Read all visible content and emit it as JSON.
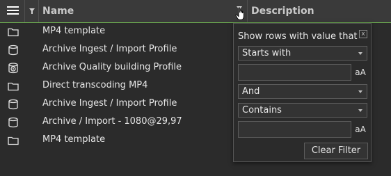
{
  "header": {
    "menu_icon": "hamburger-menu-icon",
    "filter_icon": "funnel-icon",
    "name_label": "Name",
    "description_label": "Description"
  },
  "rows": [
    {
      "icon": "folder-icon",
      "name": "MP4 template"
    },
    {
      "icon": "database-icon",
      "name": "Archive Ingest / Import Profile"
    },
    {
      "icon": "database-gear-icon",
      "name": "Archive Quality building Profile"
    },
    {
      "icon": "folder-icon",
      "name": "Direct transcoding MP4"
    },
    {
      "icon": "database-icon",
      "name": "Archive Ingest / Import Profile"
    },
    {
      "icon": "database-icon",
      "name": "Archive / Import - 1080@29,97"
    },
    {
      "icon": "folder-icon",
      "name": "MP4 template"
    }
  ],
  "filter_popup": {
    "title": "Show rows with value that",
    "close_label": "x",
    "condition1": "Starts with",
    "value1": "",
    "case_label": "aA",
    "operator": "And",
    "condition2": "Contains",
    "value2": "",
    "clear_label": "Clear Filter"
  },
  "colors": {
    "background": "#2b2b2b",
    "header_background": "#3a3a3a",
    "header_underline": "#6aa84f"
  }
}
